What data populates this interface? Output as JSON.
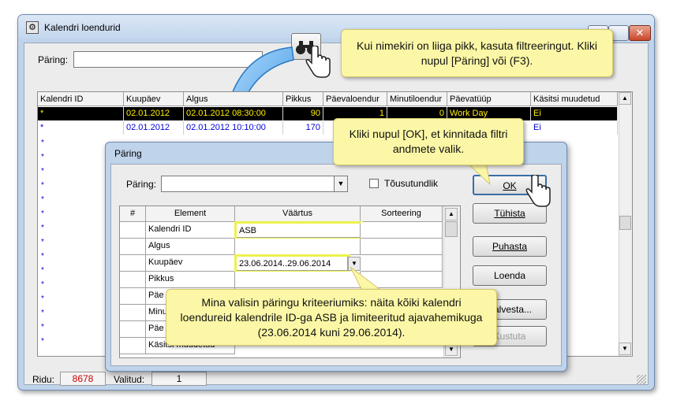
{
  "main_window": {
    "title": "Kalendri loendurid",
    "query_label": "Päring:",
    "query_value": "",
    "close_glyph": "✕",
    "status": {
      "rows_label": "Ridu:",
      "rows_value": "8678",
      "selected_label": "Valitud:",
      "selected_value": "1"
    }
  },
  "grid": {
    "columns": [
      "Kalendri ID",
      "Kuupäev",
      "Algus",
      "Pikkus",
      "Päevaloendur",
      "Minutiloendur",
      "Päevatüüp",
      "Käsitsi muudetud"
    ],
    "rows": [
      [
        "*",
        "02.01.2012",
        "02.01.2012 08:30:00",
        "90",
        "1",
        "0",
        "Work Day",
        "Ei"
      ],
      [
        "*",
        "02.01.2012",
        "02.01.2012 10:10:00",
        "170",
        "",
        "",
        "",
        "Ei"
      ]
    ],
    "marker": "*"
  },
  "dialog": {
    "title": "Päring",
    "query_label": "Päring:",
    "query_value": "",
    "ascending_label": "Tõusutundlik",
    "table_headers": [
      "#",
      "Element",
      "Väärtus",
      "Sorteering"
    ],
    "table_rows": [
      {
        "element": "Kalendri ID",
        "value": "ASB"
      },
      {
        "element": "Algus",
        "value": ""
      },
      {
        "element": "Kuupäev",
        "value": "23.06.2014..29.06.2014"
      },
      {
        "element": "Pikkus",
        "value": ""
      },
      {
        "element": "Päe",
        "value": ""
      },
      {
        "element": "Minu",
        "value": ""
      },
      {
        "element": "Päe",
        "value": ""
      },
      {
        "element": "Käsitsi muudetud",
        "value": ""
      }
    ],
    "buttons": {
      "ok": "OK",
      "cancel": "Tühista",
      "clear": "Puhasta",
      "count": "Loenda",
      "save": "Salvesta...",
      "delete": "Kustuta"
    }
  },
  "callouts": {
    "filter": "Kui nimekiri on liiga pikk, kasuta filtreeringut. Kliki nupul [Päring] või (F3).",
    "ok": "Kliki nupul [OK], et kinnitada filtri andmete valik.",
    "criteria": "Mina valisin päringu kriteeriumiks: näita kõiki kalendri loendureid kalendrile ID-ga ASB ja limiteeritud ajavahemikuga (23.06.2014 kuni 29.06.2014)."
  },
  "colors": {
    "selected_row_bg": "#000000",
    "selected_row_text": "#ffee00",
    "row_text": "#0000d8",
    "callout_bg": "#fbf7a6",
    "highlight": "#ecf24a",
    "rows_count_color": "#cc0000"
  }
}
